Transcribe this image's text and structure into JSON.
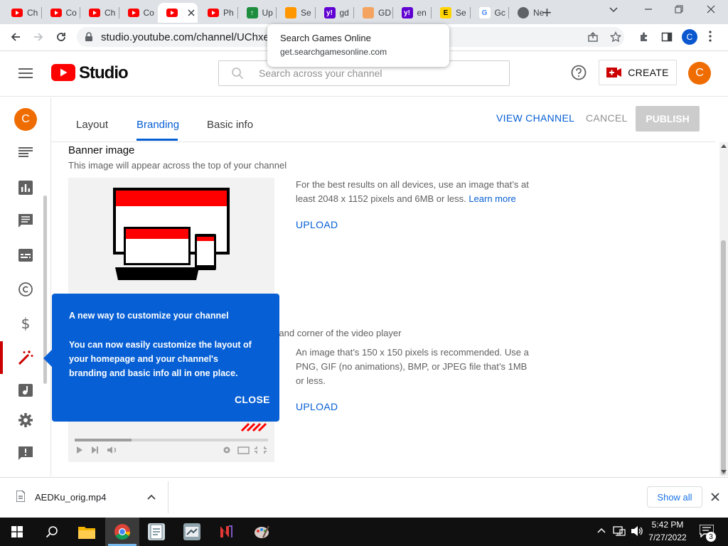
{
  "browser": {
    "tabs": [
      {
        "label": "Ch",
        "fav": "youtube-icon"
      },
      {
        "label": "Co",
        "fav": "youtube-icon"
      },
      {
        "label": "Ch",
        "fav": "youtube-icon"
      },
      {
        "label": "Co",
        "fav": "youtube-icon"
      },
      {
        "label": "",
        "fav": "youtube-icon",
        "active": true
      },
      {
        "label": "Ph",
        "fav": "youtube-icon"
      },
      {
        "label": "Up",
        "fav": "upload-icon"
      },
      {
        "label": "Se",
        "fav": "fox-icon"
      },
      {
        "label": "gd",
        "fav": "yahoo-icon"
      },
      {
        "label": "GD",
        "fav": "gd-icon"
      },
      {
        "label": "en",
        "fav": "yahoo-icon"
      },
      {
        "label": "Se",
        "fav": "e-icon"
      },
      {
        "label": "Gc",
        "fav": "google-icon"
      },
      {
        "label": "Ne",
        "fav": "globe-icon"
      }
    ],
    "new_tab": "+",
    "url": "studio.youtube.com/channel/UChxeZb",
    "hovercard": {
      "title": "Search Games Online",
      "url": "get.searchgamesonline.com"
    },
    "profile_letter": "C"
  },
  "studio": {
    "logo_text": "Studio",
    "search_placeholder": "Search across your channel",
    "create_label": "CREATE",
    "avatar_letter": "C",
    "sidebar_avatar_letter": "C"
  },
  "tabs": {
    "layout": "Layout",
    "branding": "Branding",
    "basic_info": "Basic info",
    "view_channel": "VIEW CHANNEL",
    "cancel": "CANCEL",
    "publish": "PUBLISH"
  },
  "banner": {
    "title": "Banner image",
    "subtitle": "This image will appear across the top of your channel",
    "desc": "For the best results on all devices, use an image that’s at least 2048 x 1152 pixels and 6MB or less.",
    "learn_more": "Learn more",
    "upload": "UPLOAD"
  },
  "watermark": {
    "subtitle_fragment": "nt-hand corner of the video player",
    "desc": "An image that’s 150 x 150 pixels is recommended. Use a PNG, GIF (no animations), BMP, or JPEG file that’s 1MB or less.",
    "upload": "UPLOAD"
  },
  "popover": {
    "title": "A new way to customize your channel",
    "body": "You can now easily customize the layout of your homepage and your channel's branding and basic info all in one place.",
    "close": "CLOSE"
  },
  "downloads": {
    "file": "AEDKu_orig.mp4",
    "show_all": "Show all"
  },
  "taskbar": {
    "time": "5:42 PM",
    "date": "7/27/2022",
    "notif_count": "3"
  },
  "colors": {
    "accent": "#065fd4",
    "youtube_red": "#ff0000",
    "avatar_orange": "#ef6c00"
  }
}
